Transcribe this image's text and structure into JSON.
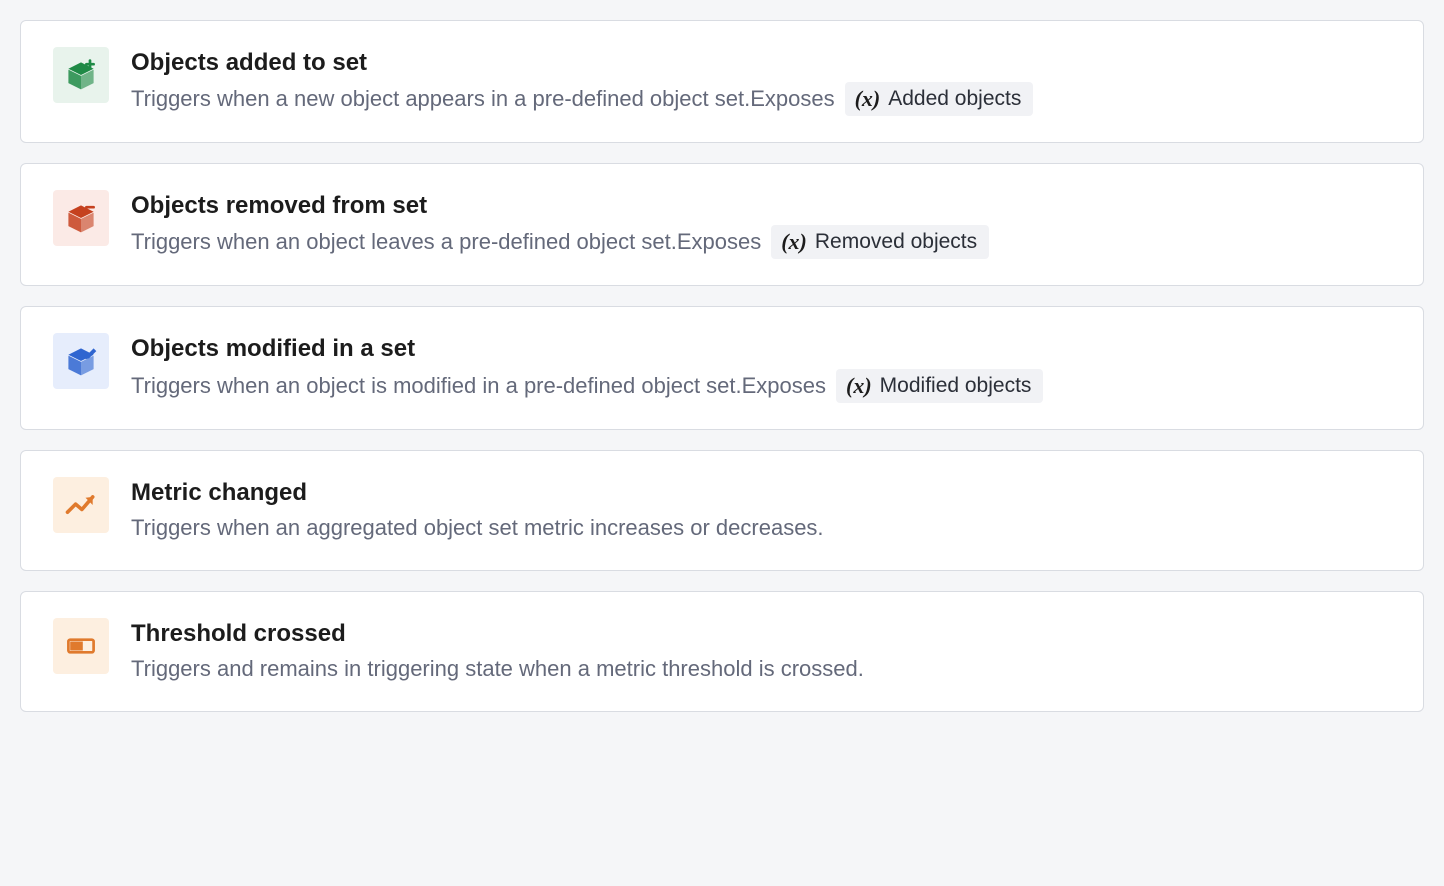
{
  "triggers": [
    {
      "id": "objects-added",
      "title": "Objects added to set",
      "description": "Triggers when a new object appears in a pre-defined object set.Exposes",
      "badge": "Added objects",
      "icon": "cube-plus",
      "icon_bg": "#e8f3ec",
      "icon_fg": "#1f8a46"
    },
    {
      "id": "objects-removed",
      "title": "Objects removed from set",
      "description": "Triggers when an object leaves a pre-defined object set.Exposes",
      "badge": "Removed objects",
      "icon": "cube-minus",
      "icon_bg": "#fbeae6",
      "icon_fg": "#c5411f"
    },
    {
      "id": "objects-modified",
      "title": "Objects modified in a set",
      "description": "Triggers when an object is modified in a pre-defined object set.Exposes",
      "badge": "Modified objects",
      "icon": "cube-edit",
      "icon_bg": "#e6edfc",
      "icon_fg": "#2f65d0"
    },
    {
      "id": "metric-changed",
      "title": "Metric changed",
      "description": "Triggers when an aggregated object set metric increases or decreases.",
      "badge": null,
      "icon": "trend-arrow",
      "icon_bg": "#fdefe0",
      "icon_fg": "#e07a2d"
    },
    {
      "id": "threshold-crossed",
      "title": "Threshold crossed",
      "description": "Triggers and remains in triggering state when a metric threshold is crossed.",
      "badge": null,
      "icon": "threshold-bar",
      "icon_bg": "#fdefe0",
      "icon_fg": "#e07a2d"
    }
  ]
}
